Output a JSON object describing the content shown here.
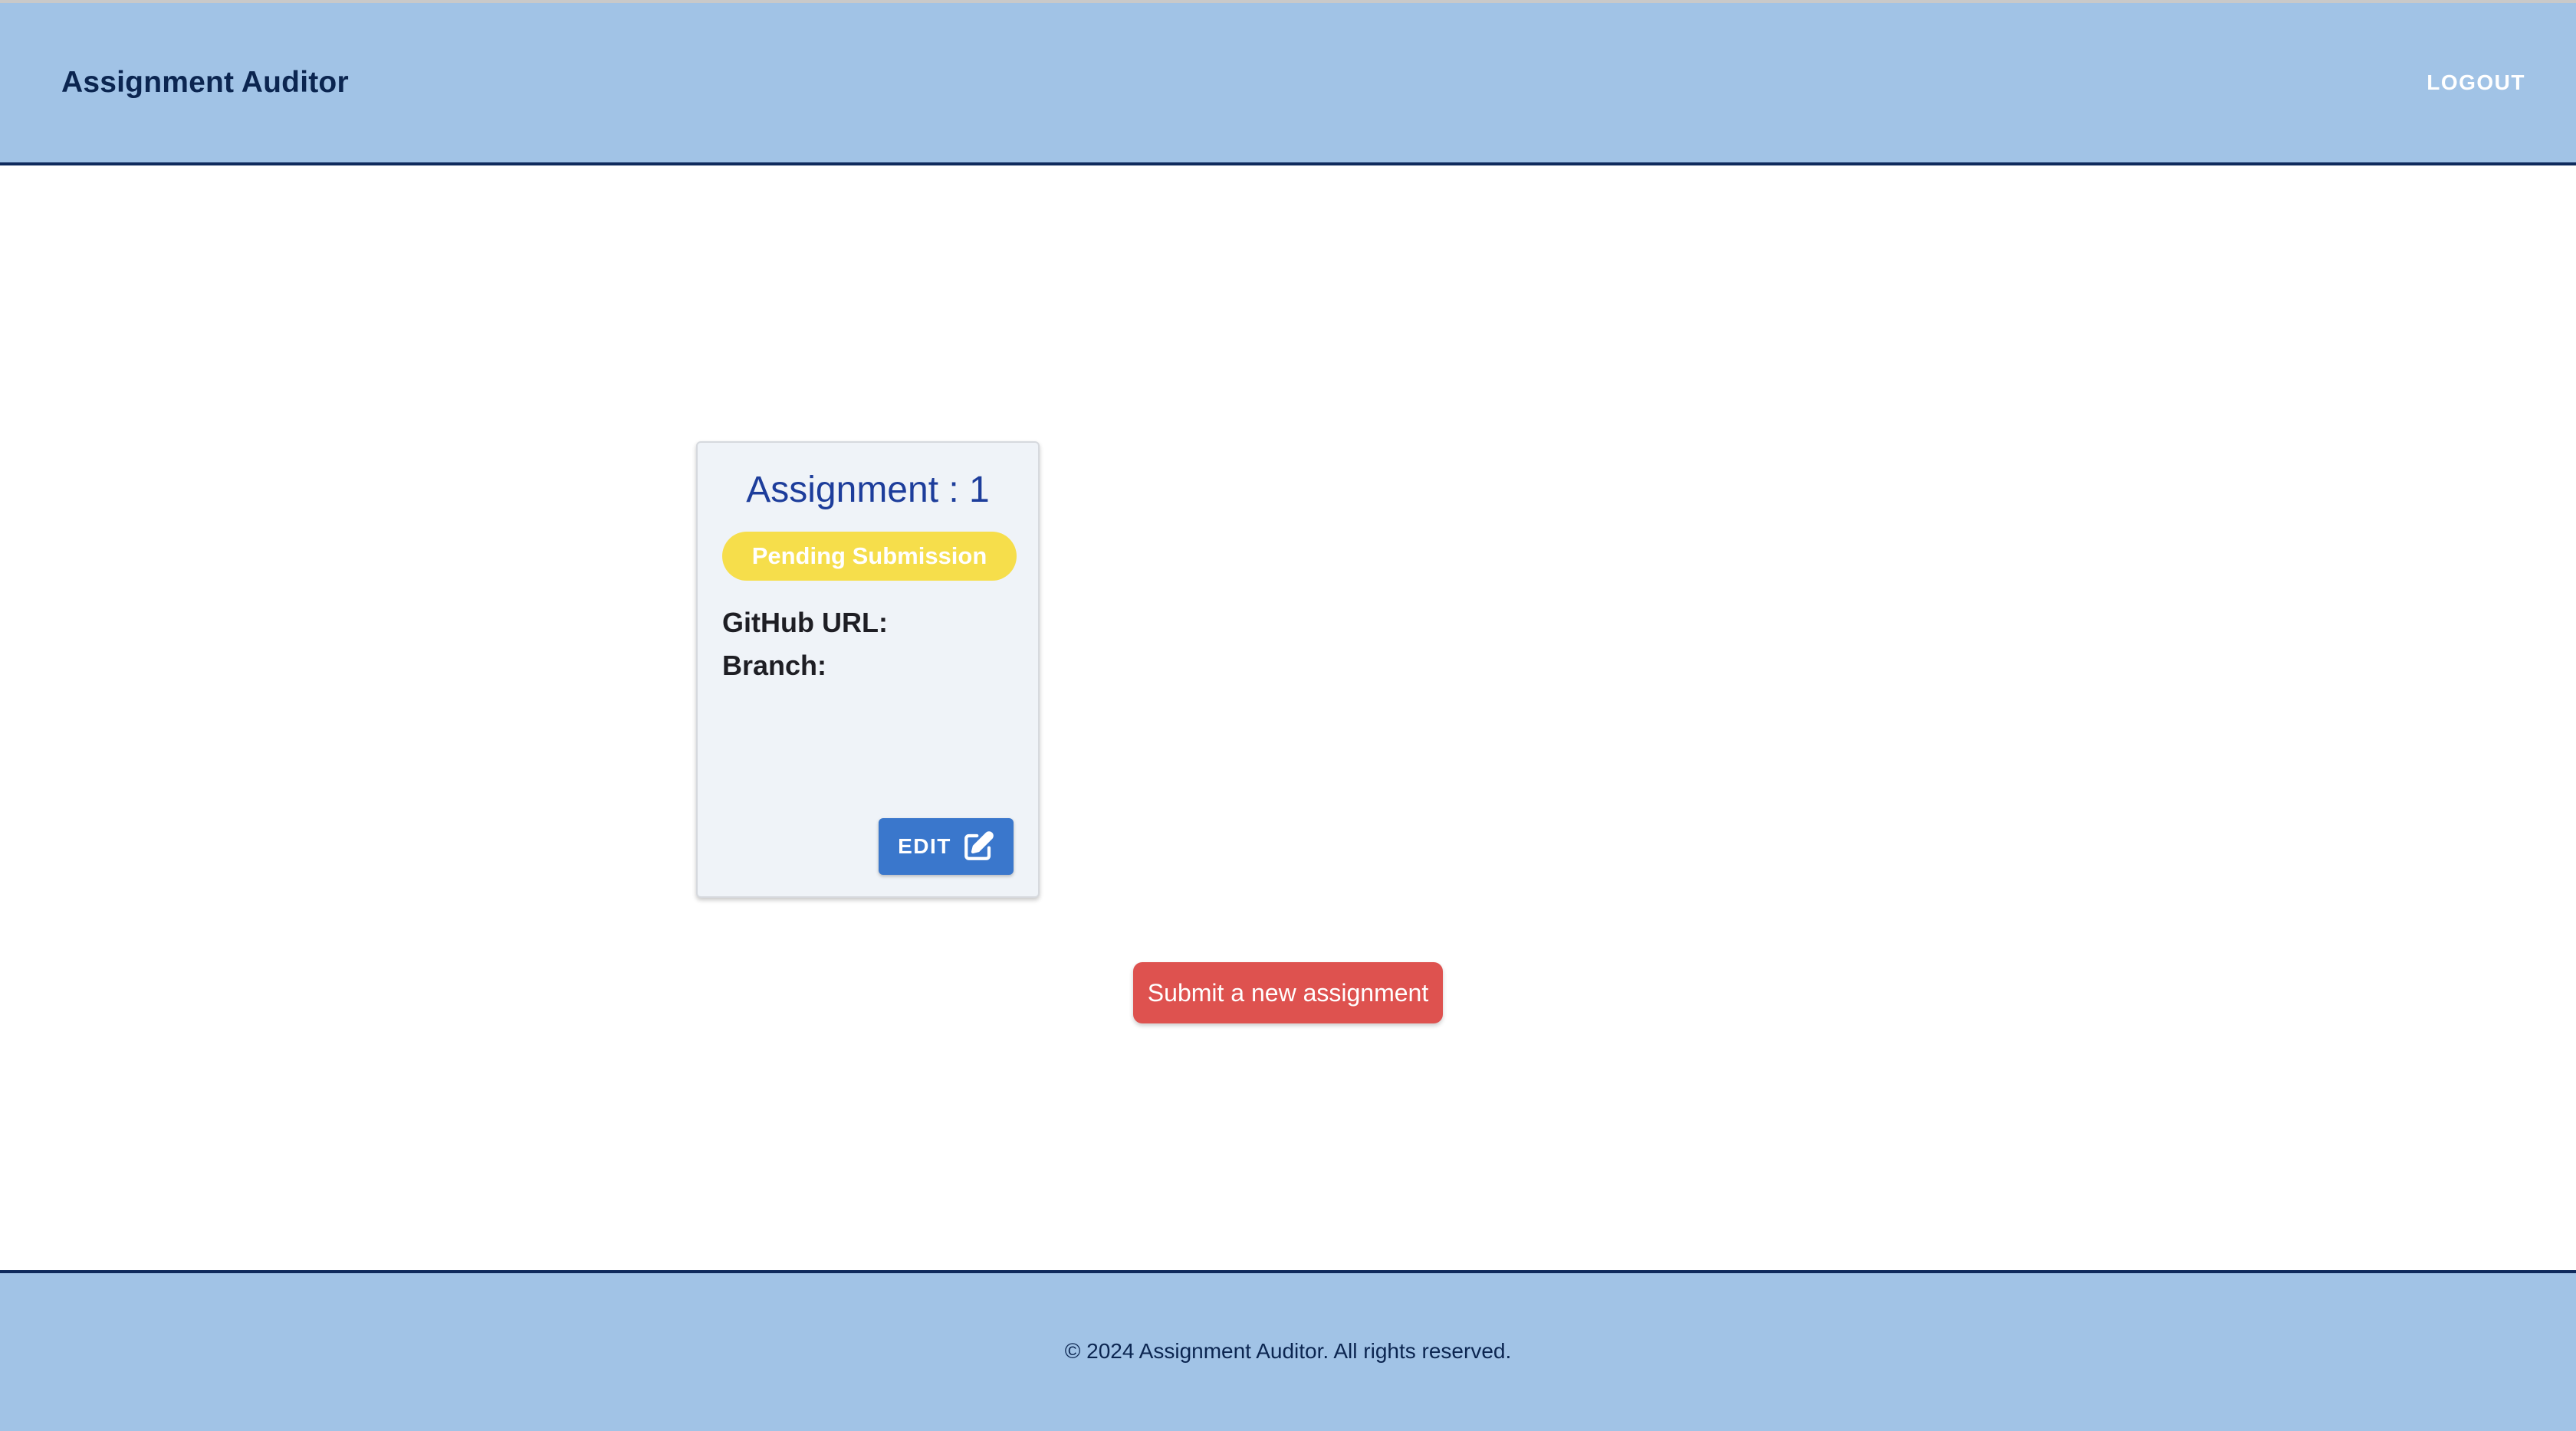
{
  "header": {
    "brand": "Assignment Auditor",
    "logout_label": "LOGOUT"
  },
  "assignment_card": {
    "title": "Assignment : 1",
    "status": "Pending Submission",
    "github_url_label": "GitHub URL:",
    "branch_label": "Branch:",
    "edit_label": "EDIT",
    "edit_icon": "edit-icon"
  },
  "actions": {
    "submit_new_label": "Submit a new assignment"
  },
  "footer": {
    "copyright": "© 2024 Assignment Auditor. All rights reserved."
  },
  "colors": {
    "header_bg": "#a1c3e6",
    "navy": "#0b2550",
    "status_yellow": "#f6de4b",
    "edit_blue": "#3a77cc",
    "submit_red": "#de524f"
  }
}
